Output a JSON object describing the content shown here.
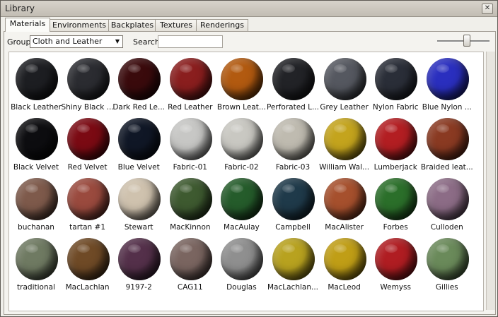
{
  "window": {
    "title": "Library"
  },
  "tabs": [
    "Materials",
    "Environments",
    "Backplates",
    "Textures",
    "Renderings"
  ],
  "toolbar": {
    "group_label": "Group",
    "group_value": "Cloth and Leather",
    "search_label": "Search",
    "search_value": "",
    "zoom_level": 0.55
  },
  "materials": [
    {
      "label": "Black Leather",
      "color": "#1d1e22"
    },
    {
      "label": "Shiny Black ...",
      "color": "#2b2c31"
    },
    {
      "label": "Dark Red Le...",
      "color": "#3a0a0c"
    },
    {
      "label": "Red Leather",
      "color": "#8a1e1e"
    },
    {
      "label": "Brown Leat...",
      "color": "#b25a10"
    },
    {
      "label": "Perforated L...",
      "color": "#222327"
    },
    {
      "label": "Grey Leather",
      "color": "#555860"
    },
    {
      "label": "Nylon Fabric",
      "color": "#2a2e38"
    },
    {
      "label": "Blue Nylon ...",
      "color": "#2a2fbf"
    },
    {
      "label": "Black Velvet",
      "color": "#0d0d10"
    },
    {
      "label": "Red Velvet",
      "color": "#7b0a13"
    },
    {
      "label": "Blue Velvet",
      "color": "#101726"
    },
    {
      "label": "Fabric-01",
      "color": "#c7c7c5"
    },
    {
      "label": "Fabric-02",
      "color": "#c9c8c2"
    },
    {
      "label": "Fabric-03",
      "color": "#bfbbb0"
    },
    {
      "label": "William Wal...",
      "color": "#c4a41d"
    },
    {
      "label": "Lumberjack",
      "color": "#b31e22"
    },
    {
      "label": "Braided leat...",
      "color": "#8a3a22"
    },
    {
      "label": "buchanan",
      "color": "#7e5a4b"
    },
    {
      "label": "tartan #1",
      "color": "#9a4a3e"
    },
    {
      "label": "Stewart",
      "color": "#cfc2ae"
    },
    {
      "label": "MacKinnon",
      "color": "#3e5a30"
    },
    {
      "label": "MacAulay",
      "color": "#255c2b"
    },
    {
      "label": "Campbell",
      "color": "#1f3a4a"
    },
    {
      "label": "MacAlister",
      "color": "#a6502d"
    },
    {
      "label": "Forbes",
      "color": "#2b6f2a"
    },
    {
      "label": "Culloden",
      "color": "#8c6c86"
    },
    {
      "label": "traditional",
      "color": "#6f7a62"
    },
    {
      "label": "MacLachlan",
      "color": "#6f4a26"
    },
    {
      "label": "9197-2",
      "color": "#54304a"
    },
    {
      "label": "CAG11",
      "color": "#7a6560"
    },
    {
      "label": "Douglas",
      "color": "#8f8f8f"
    },
    {
      "label": "MacLachlan...",
      "color": "#b8a21f"
    },
    {
      "label": "MacLeod",
      "color": "#c09e16"
    },
    {
      "label": "Wemyss",
      "color": "#b01d22"
    },
    {
      "label": "Gillies",
      "color": "#6a8a5a"
    }
  ]
}
